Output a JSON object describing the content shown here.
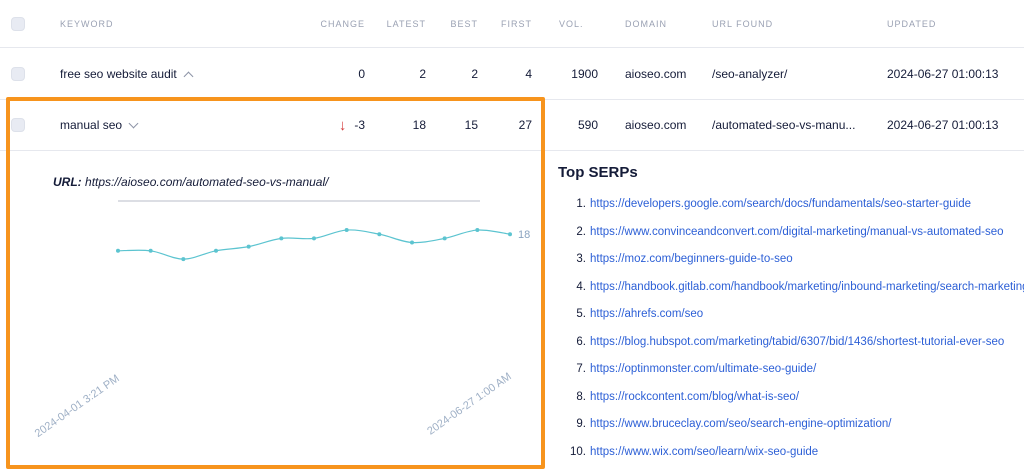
{
  "columns": {
    "keyword": "KEYWORD",
    "change": "CHANGE",
    "latest": "LATEST",
    "best": "BEST",
    "first": "FIRST",
    "vol": "VOL.",
    "domain": "DOMAIN",
    "url_found": "URL FOUND",
    "updated": "UPDATED"
  },
  "rows": [
    {
      "keyword": "free seo website audit",
      "change": "0",
      "latest": "2",
      "best": "2",
      "first": "4",
      "vol": "1900",
      "domain": "aioseo.com",
      "url_found": "/seo-analyzer/",
      "updated": "2024-06-27 01:00:13"
    },
    {
      "keyword": "manual seo",
      "change_arrow": "↓",
      "change": "-3",
      "latest": "18",
      "best": "15",
      "first": "27",
      "vol": "590",
      "domain": "aioseo.com",
      "url_found": "/automated-seo-vs-manu...",
      "updated": "2024-06-27 01:00:13"
    }
  ],
  "detail": {
    "url_label": "URL:",
    "url_value": "https://aioseo.com/automated-seo-vs-manual/"
  },
  "chart_data": {
    "type": "line",
    "title": "",
    "xlabel": "",
    "ylabel": "",
    "x_start_label": "2024-04-01 3:21 PM",
    "x_end_label": "2024-06-27 1:00 AM",
    "series": [
      {
        "values": [
          22,
          22,
          24,
          22,
          21,
          19,
          19,
          17,
          18,
          20,
          19,
          17,
          18
        ]
      }
    ],
    "end_label": "18",
    "ylim": [
      1,
      100
    ],
    "y_reversed": true,
    "grid": false,
    "line_color": "#5cc4d0"
  },
  "serps": {
    "title": "Top SERPs",
    "items": [
      {
        "num": "1.",
        "url": "https://developers.google.com/search/docs/fundamentals/seo-starter-guide"
      },
      {
        "num": "2.",
        "url": "https://www.convinceandconvert.com/digital-marketing/manual-vs-automated-seo"
      },
      {
        "num": "3.",
        "url": "https://moz.com/beginners-guide-to-seo"
      },
      {
        "num": "4.",
        "url": "https://handbook.gitlab.com/handbook/marketing/inbound-marketing/search-marketing"
      },
      {
        "num": "5.",
        "url": "https://ahrefs.com/seo"
      },
      {
        "num": "6.",
        "url": "https://blog.hubspot.com/marketing/tabid/6307/bid/1436/shortest-tutorial-ever-seo"
      },
      {
        "num": "7.",
        "url": "https://optinmonster.com/ultimate-seo-guide/"
      },
      {
        "num": "8.",
        "url": "https://rockcontent.com/blog/what-is-seo/"
      },
      {
        "num": "9.",
        "url": "https://www.bruceclay.com/seo/search-engine-optimization/"
      },
      {
        "num": "10.",
        "url": "https://www.wix.com/seo/learn/wix-seo-guide"
      }
    ]
  },
  "colors": {
    "accent_highlight": "#f7941d",
    "link": "#2c5fd6",
    "decrease": "#d43b3b",
    "chart_line": "#5cc4d0"
  }
}
